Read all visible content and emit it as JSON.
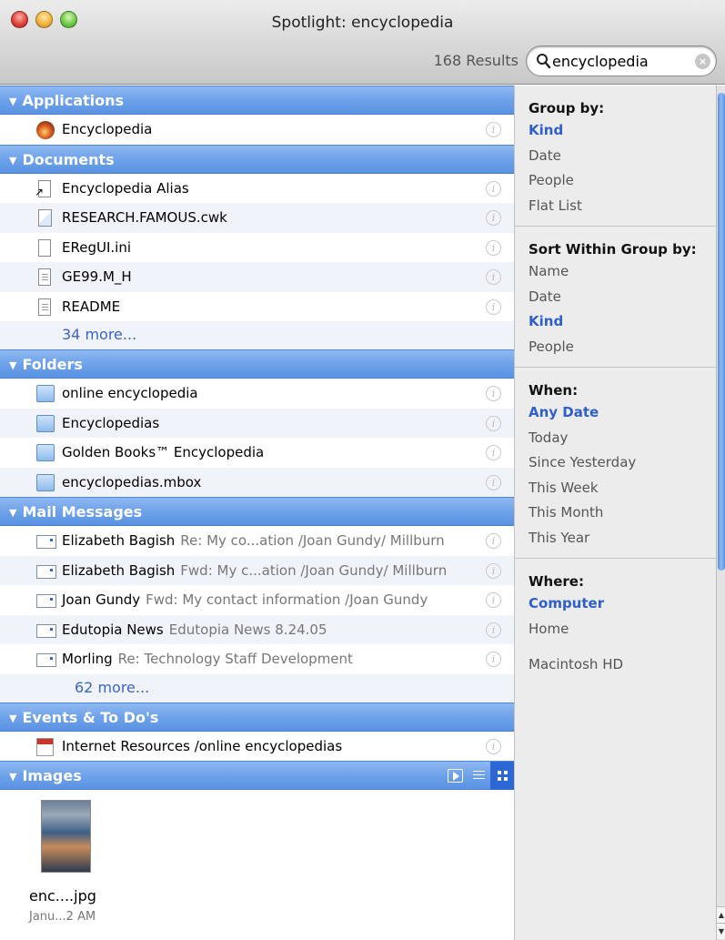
{
  "window": {
    "title": "Spotlight: encyclopedia",
    "results": "168 Results"
  },
  "search": {
    "value": "encyclopedia"
  },
  "sections": {
    "applications": {
      "title": "Applications",
      "items": [
        "Encyclopedia"
      ]
    },
    "documents": {
      "title": "Documents",
      "items": [
        "Encyclopedia Alias",
        "RESEARCH.FAMOUS.cwk",
        "ERegUI.ini",
        "GE99.M_H",
        "README"
      ],
      "more": "34 more..."
    },
    "folders": {
      "title": "Folders",
      "items": [
        "online encyclopedia",
        "Encyclopedias",
        "Golden Books™ Encyclopedia",
        "encyclopedias.mbox"
      ]
    },
    "mail": {
      "title": "Mail Messages",
      "items": [
        {
          "from": "Elizabeth Bagish",
          "subject": "Re: My co...ation /Joan Gundy/ Millburn"
        },
        {
          "from": "Elizabeth Bagish",
          "subject": "Fwd: My c...ation /Joan Gundy/ Millburn"
        },
        {
          "from": "Joan Gundy",
          "subject": "Fwd: My contact information /Joan Gundy"
        },
        {
          "from": "Edutopia News",
          "subject": "Edutopia News 8.24.05"
        },
        {
          "from": "Morling",
          "subject": "Re: Technology Staff Development"
        }
      ],
      "more": "62 more..."
    },
    "events": {
      "title": "Events & To Do's",
      "items": [
        "Internet Resources /online encyclopedias"
      ]
    },
    "images": {
      "title": "Images",
      "items": [
        {
          "name": "enc....jpg",
          "date": "Janu...2 AM"
        }
      ]
    }
  },
  "sidebar": {
    "group_by": {
      "title": "Group by:",
      "options": [
        "Kind",
        "Date",
        "People",
        "Flat List"
      ],
      "selected": "Kind"
    },
    "sort_by": {
      "title": "Sort Within Group by:",
      "options": [
        "Name",
        "Date",
        "Kind",
        "People"
      ],
      "selected": "Kind"
    },
    "when": {
      "title": "When:",
      "options": [
        "Any Date",
        "Today",
        "Since Yesterday",
        "This Week",
        "This Month",
        "This Year"
      ],
      "selected": "Any Date"
    },
    "where": {
      "title": "Where:",
      "options": [
        "Computer",
        "Home",
        "Macintosh HD"
      ],
      "selected": "Computer"
    }
  },
  "icons": {
    "info": "i",
    "clear": "×"
  }
}
